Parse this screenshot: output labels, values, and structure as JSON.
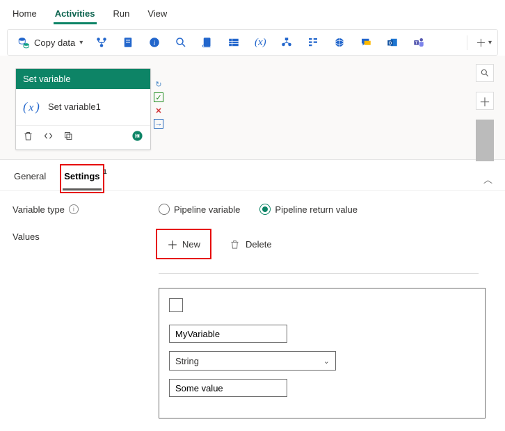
{
  "main_tabs": {
    "home": "Home",
    "activities": "Activities",
    "run": "Run",
    "view": "View"
  },
  "toolbar": {
    "copy_data_label": "Copy data",
    "icons": {
      "branch": "branch",
      "notebook": "notebook",
      "info": "info",
      "search": "search",
      "script": "script",
      "table": "table",
      "fx": "(x)",
      "dataflow": "dataflow",
      "form": "form",
      "globe": "globe",
      "chat": "chat",
      "outlook": "outlook",
      "teams": "teams"
    }
  },
  "card": {
    "title": "Set variable",
    "name": "Set variable1"
  },
  "prop_tabs": {
    "general": "General",
    "settings": "Settings",
    "settings_badge": "1"
  },
  "variable_type": {
    "label": "Variable type",
    "pipeline_variable": "Pipeline variable",
    "pipeline_return_value": "Pipeline return value"
  },
  "values": {
    "label": "Values",
    "new_btn": "New",
    "delete_btn": "Delete",
    "name_value": "MyVariable",
    "type_value": "String",
    "val_value": "Some value"
  }
}
